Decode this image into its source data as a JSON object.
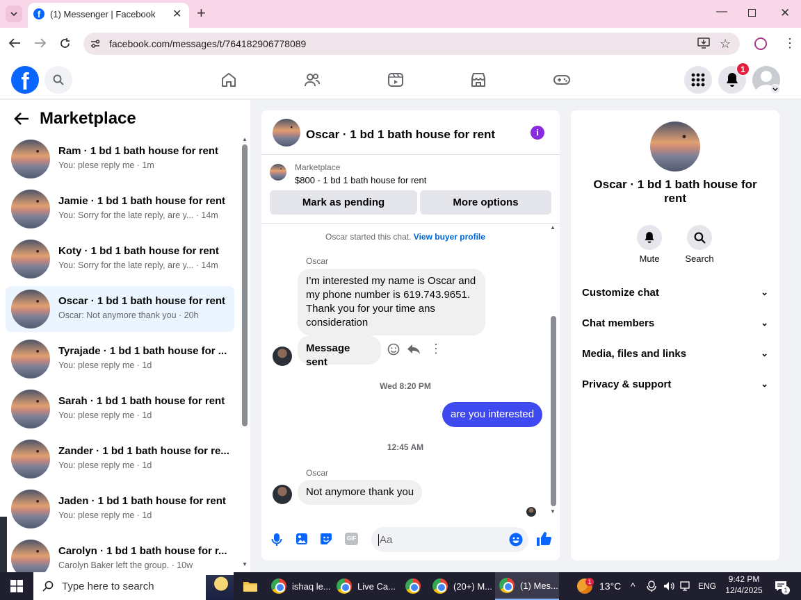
{
  "browser": {
    "tab_title": "(1) Messenger | Facebook",
    "url": "facebook.com/messages/t/764182906778089"
  },
  "header": {
    "notification_count": "1"
  },
  "left": {
    "title": "Marketplace",
    "conversations": [
      {
        "name": "Ram · 1 bd 1 bath house for rent",
        "preview": "You: plese reply me · 1m"
      },
      {
        "name": "Jamie · 1 bd 1 bath house for rent",
        "preview": "You: Sorry for the late reply, are y... · 14m"
      },
      {
        "name": "Koty · 1 bd 1 bath house for rent",
        "preview": "You: Sorry for the late reply, are y... · 14m"
      },
      {
        "name": "Oscar · 1 bd 1 bath house for rent",
        "preview": "Oscar: Not anymore thank you · 20h"
      },
      {
        "name": "Tyrajade · 1 bd 1 bath house for ...",
        "preview": "You: plese reply me · 1d"
      },
      {
        "name": "Sarah · 1 bd 1 bath house for rent",
        "preview": "You: plese reply me · 1d"
      },
      {
        "name": "Zander · 1 bd 1 bath house for re...",
        "preview": "You: plese reply me · 1d"
      },
      {
        "name": "Jaden · 1 bd 1 bath house for rent",
        "preview": "You: plese reply me · 1d"
      },
      {
        "name": "Carolyn · 1 bd 1 bath house for r...",
        "preview": "Carolyn Baker left the group. · 10w"
      }
    ]
  },
  "chat": {
    "title": "Oscar · 1 bd 1 bath house for rent",
    "listing_source": "Marketplace",
    "listing": "$800 - 1 bd 1 bath house for rent",
    "mark_pending": "Mark as pending",
    "more_options": "More options",
    "started_text": "Oscar started this chat.",
    "view_profile": "View buyer profile",
    "sender1": "Oscar",
    "msg1": "I’m interested my name is Oscar and my phone number is 619.743.9651. Thank you for your time ans consideration",
    "msg2": "Message sent",
    "time1": "Wed 8:20 PM",
    "msg3": "are you interested",
    "time2": "12:45 AM",
    "sender2": "Oscar",
    "msg4": "Not anymore thank you",
    "input_placeholder": "Aa"
  },
  "right": {
    "name": "Oscar · 1 bd 1 bath house for rent",
    "mute": "Mute",
    "search": "Search",
    "sections": [
      "Customize chat",
      "Chat members",
      "Media, files and links",
      "Privacy & support"
    ]
  },
  "taskbar": {
    "search_placeholder": "Type here to search",
    "apps": [
      "ishaq le...",
      "Live Ca...",
      "(20+) M...",
      "(1) Mes..."
    ],
    "temperature": "13°C",
    "language": "ENG",
    "time": "9:42 PM",
    "date": "12/4/2025",
    "weather_badge": "1",
    "notif_count": "1"
  },
  "colors": {
    "fb_blue": "#0866ff",
    "messenger_bubble": "#3e49f0",
    "active_conv": "#ebf5ff",
    "info_purple": "#8a2be2"
  }
}
